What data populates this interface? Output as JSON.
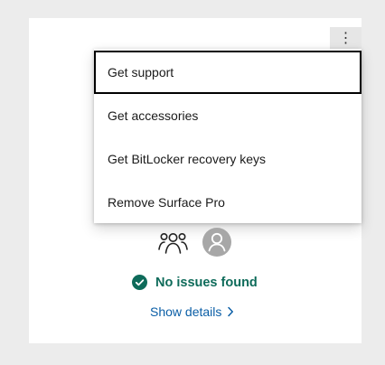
{
  "device_card": {
    "more_icon": "vertical-ellipsis",
    "more_glyph": "⋮",
    "people_icon": "people-group-icon",
    "avatar_icon": "person-avatar-icon",
    "status": {
      "icon": "check-circle-icon",
      "text": "No issues found",
      "color": "#0e6b5a"
    },
    "details_link": {
      "text": "Show details",
      "icon": "chevron-right-icon",
      "color": "#0a5ea6"
    }
  },
  "menu": {
    "items": [
      {
        "label": "Get support",
        "focused": true
      },
      {
        "label": "Get accessories",
        "focused": false
      },
      {
        "label": "Get BitLocker recovery keys",
        "focused": false
      },
      {
        "label": "Remove Surface Pro",
        "focused": false
      }
    ]
  }
}
